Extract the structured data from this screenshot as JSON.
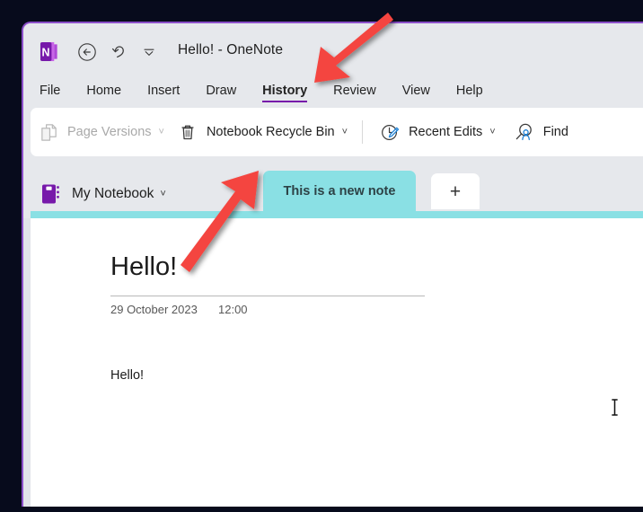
{
  "window": {
    "title": "Hello!  -  OneNote",
    "app_name": "OneNote",
    "accent_purple": "#7719aa",
    "section_color": "#8ae0e4",
    "background": "#070b1c"
  },
  "titlebar": {
    "logo_letter": "N",
    "back_icon": "back-arrow-icon",
    "undo_icon": "undo-arrow-icon",
    "more_icon": "chevron-down-icon"
  },
  "ribbon_tabs": [
    {
      "label": "File",
      "active": false
    },
    {
      "label": "Home",
      "active": false
    },
    {
      "label": "Insert",
      "active": false
    },
    {
      "label": "Draw",
      "active": false
    },
    {
      "label": "History",
      "active": true
    },
    {
      "label": "Review",
      "active": false
    },
    {
      "label": "View",
      "active": false
    },
    {
      "label": "Help",
      "active": false
    }
  ],
  "ribbon_commands": [
    {
      "label": "Page Versions",
      "icon": "page-versions-icon",
      "chevron": "˅",
      "disabled": true
    },
    {
      "label": "Notebook Recycle Bin",
      "icon": "recycle-bin-icon",
      "chevron": "˅",
      "disabled": false
    },
    {
      "label": "Recent Edits",
      "icon": "recent-edits-icon",
      "chevron": "˅",
      "disabled": false
    },
    {
      "label": "Find",
      "icon": "find-by-author-icon",
      "chevron": "",
      "disabled": false
    }
  ],
  "navigation": {
    "notebook_label": "My Notebook",
    "notebook_chevron": "˅",
    "notebook_icon": "notebook-icon",
    "section_tab_label": "This is a new note",
    "add_tab_label": "+"
  },
  "page": {
    "title": "Hello!",
    "date": "29 October 2023",
    "time": "12:00",
    "body": "Hello!"
  },
  "annotations": {
    "arrow_color": "#f4453f",
    "arrow_1_target": "History",
    "arrow_2_target": "Notebook Recycle Bin"
  },
  "cursor": {
    "type": "text-ibeam"
  }
}
